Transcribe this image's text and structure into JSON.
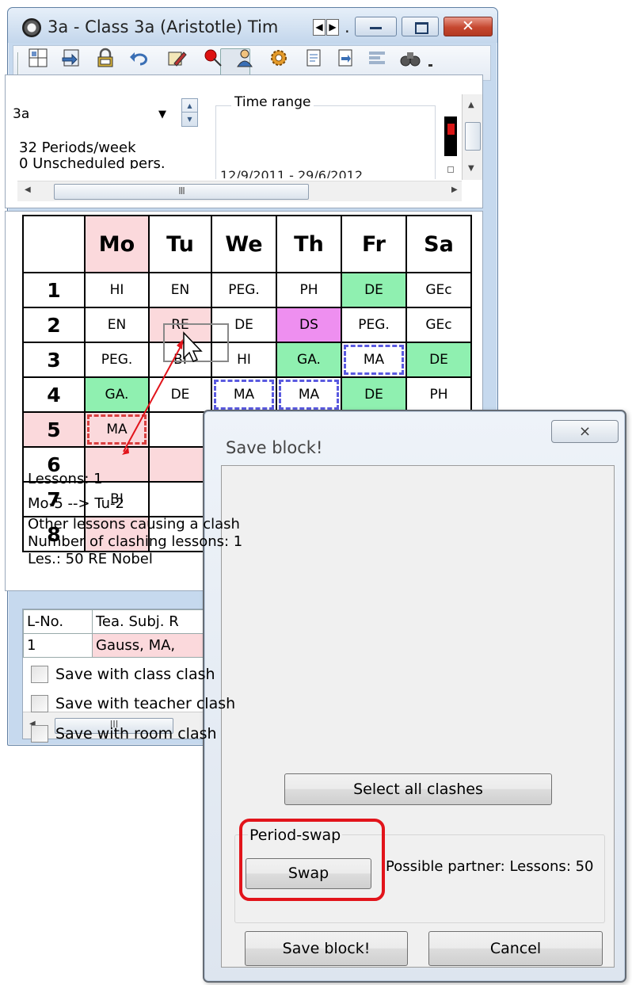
{
  "main_window": {
    "title": "3a - Class 3a (Aristotle)  Tim",
    "title_ellipsis": ".",
    "tab_scroll_left": "◀",
    "tab_scroll_right": "▶",
    "close_glyph": "✕"
  },
  "toolbar": {
    "icons": [
      "cell-icon",
      "import-icon",
      "lock-icon",
      "undo-icon",
      "draw-icon",
      "pin-icon",
      "teacher-icon",
      "settings-icon",
      "document-icon",
      "form-icon",
      "layout-icon",
      "binoculars-icon",
      "dropdown-icon"
    ]
  },
  "info": {
    "class_value": "3a",
    "periods_week": "32  Periods/week",
    "unscheduled": "0  Unscheduled pers.",
    "time_range_label": "Time range",
    "time_range_dates": "12/9/2011 - 29/6/2012",
    "hscroll_grip": "III"
  },
  "timetable": {
    "days": [
      "Mo",
      "Tu",
      "We",
      "Th",
      "Fr",
      "Sa"
    ],
    "rows": [
      {
        "period": "1",
        "cells": [
          "HI",
          "EN",
          "PEG.",
          "PH",
          "DE",
          "GEc"
        ]
      },
      {
        "period": "2",
        "cells": [
          "EN",
          "RE",
          "DE",
          "DS",
          "PEG.",
          "GEc"
        ]
      },
      {
        "period": "3",
        "cells": [
          "PEG.",
          "BI",
          "HI",
          "GA.",
          "MA",
          "DE"
        ]
      },
      {
        "period": "4",
        "cells": [
          "GA.",
          "DE",
          "MA",
          "MA",
          "DE",
          "PH"
        ]
      },
      {
        "period": "5",
        "cells": [
          "MA",
          "",
          "",
          "",
          "",
          ""
        ]
      },
      {
        "period": "6",
        "cells": [
          "",
          "",
          "",
          "",
          "",
          ""
        ]
      },
      {
        "period": "7",
        "cells": [
          "BI",
          "",
          "",
          "",
          "",
          ""
        ]
      },
      {
        "period": "8",
        "cells": [
          "",
          "",
          "",
          "",
          "",
          ""
        ]
      }
    ]
  },
  "lesson_list": {
    "headers": [
      "L-No.",
      "Tea. Subj. R"
    ],
    "rows": [
      [
        "1",
        "Gauss, MA,"
      ]
    ],
    "hscroll_grip": "III"
  },
  "dialog": {
    "title": "Save block!",
    "close_glyph": "⨯",
    "lessons": "Lessons: 1",
    "move": "Mo-5 --> Tu-2",
    "clash_info": "Other lessons causing a clash",
    "clash_count": "Number of clashing lessons: 1",
    "clash_lesson": "Les.: 50 RE Nobel",
    "checkboxes": [
      "Save with class clash",
      "Save with teacher clash",
      "Save with room clash"
    ],
    "select_all_label": "Select all clashes",
    "period_swap_label": "Period-swap",
    "swap_label": "Swap",
    "possible_partner": "Possible partner: Lessons: 50",
    "save_block_label": "Save block!",
    "cancel_label": "Cancel"
  },
  "colors": {
    "pink": "#fbd9dc",
    "green": "#8ff0b0",
    "magenta": "#ee8ff0",
    "red_highlight": "#e2141b"
  }
}
